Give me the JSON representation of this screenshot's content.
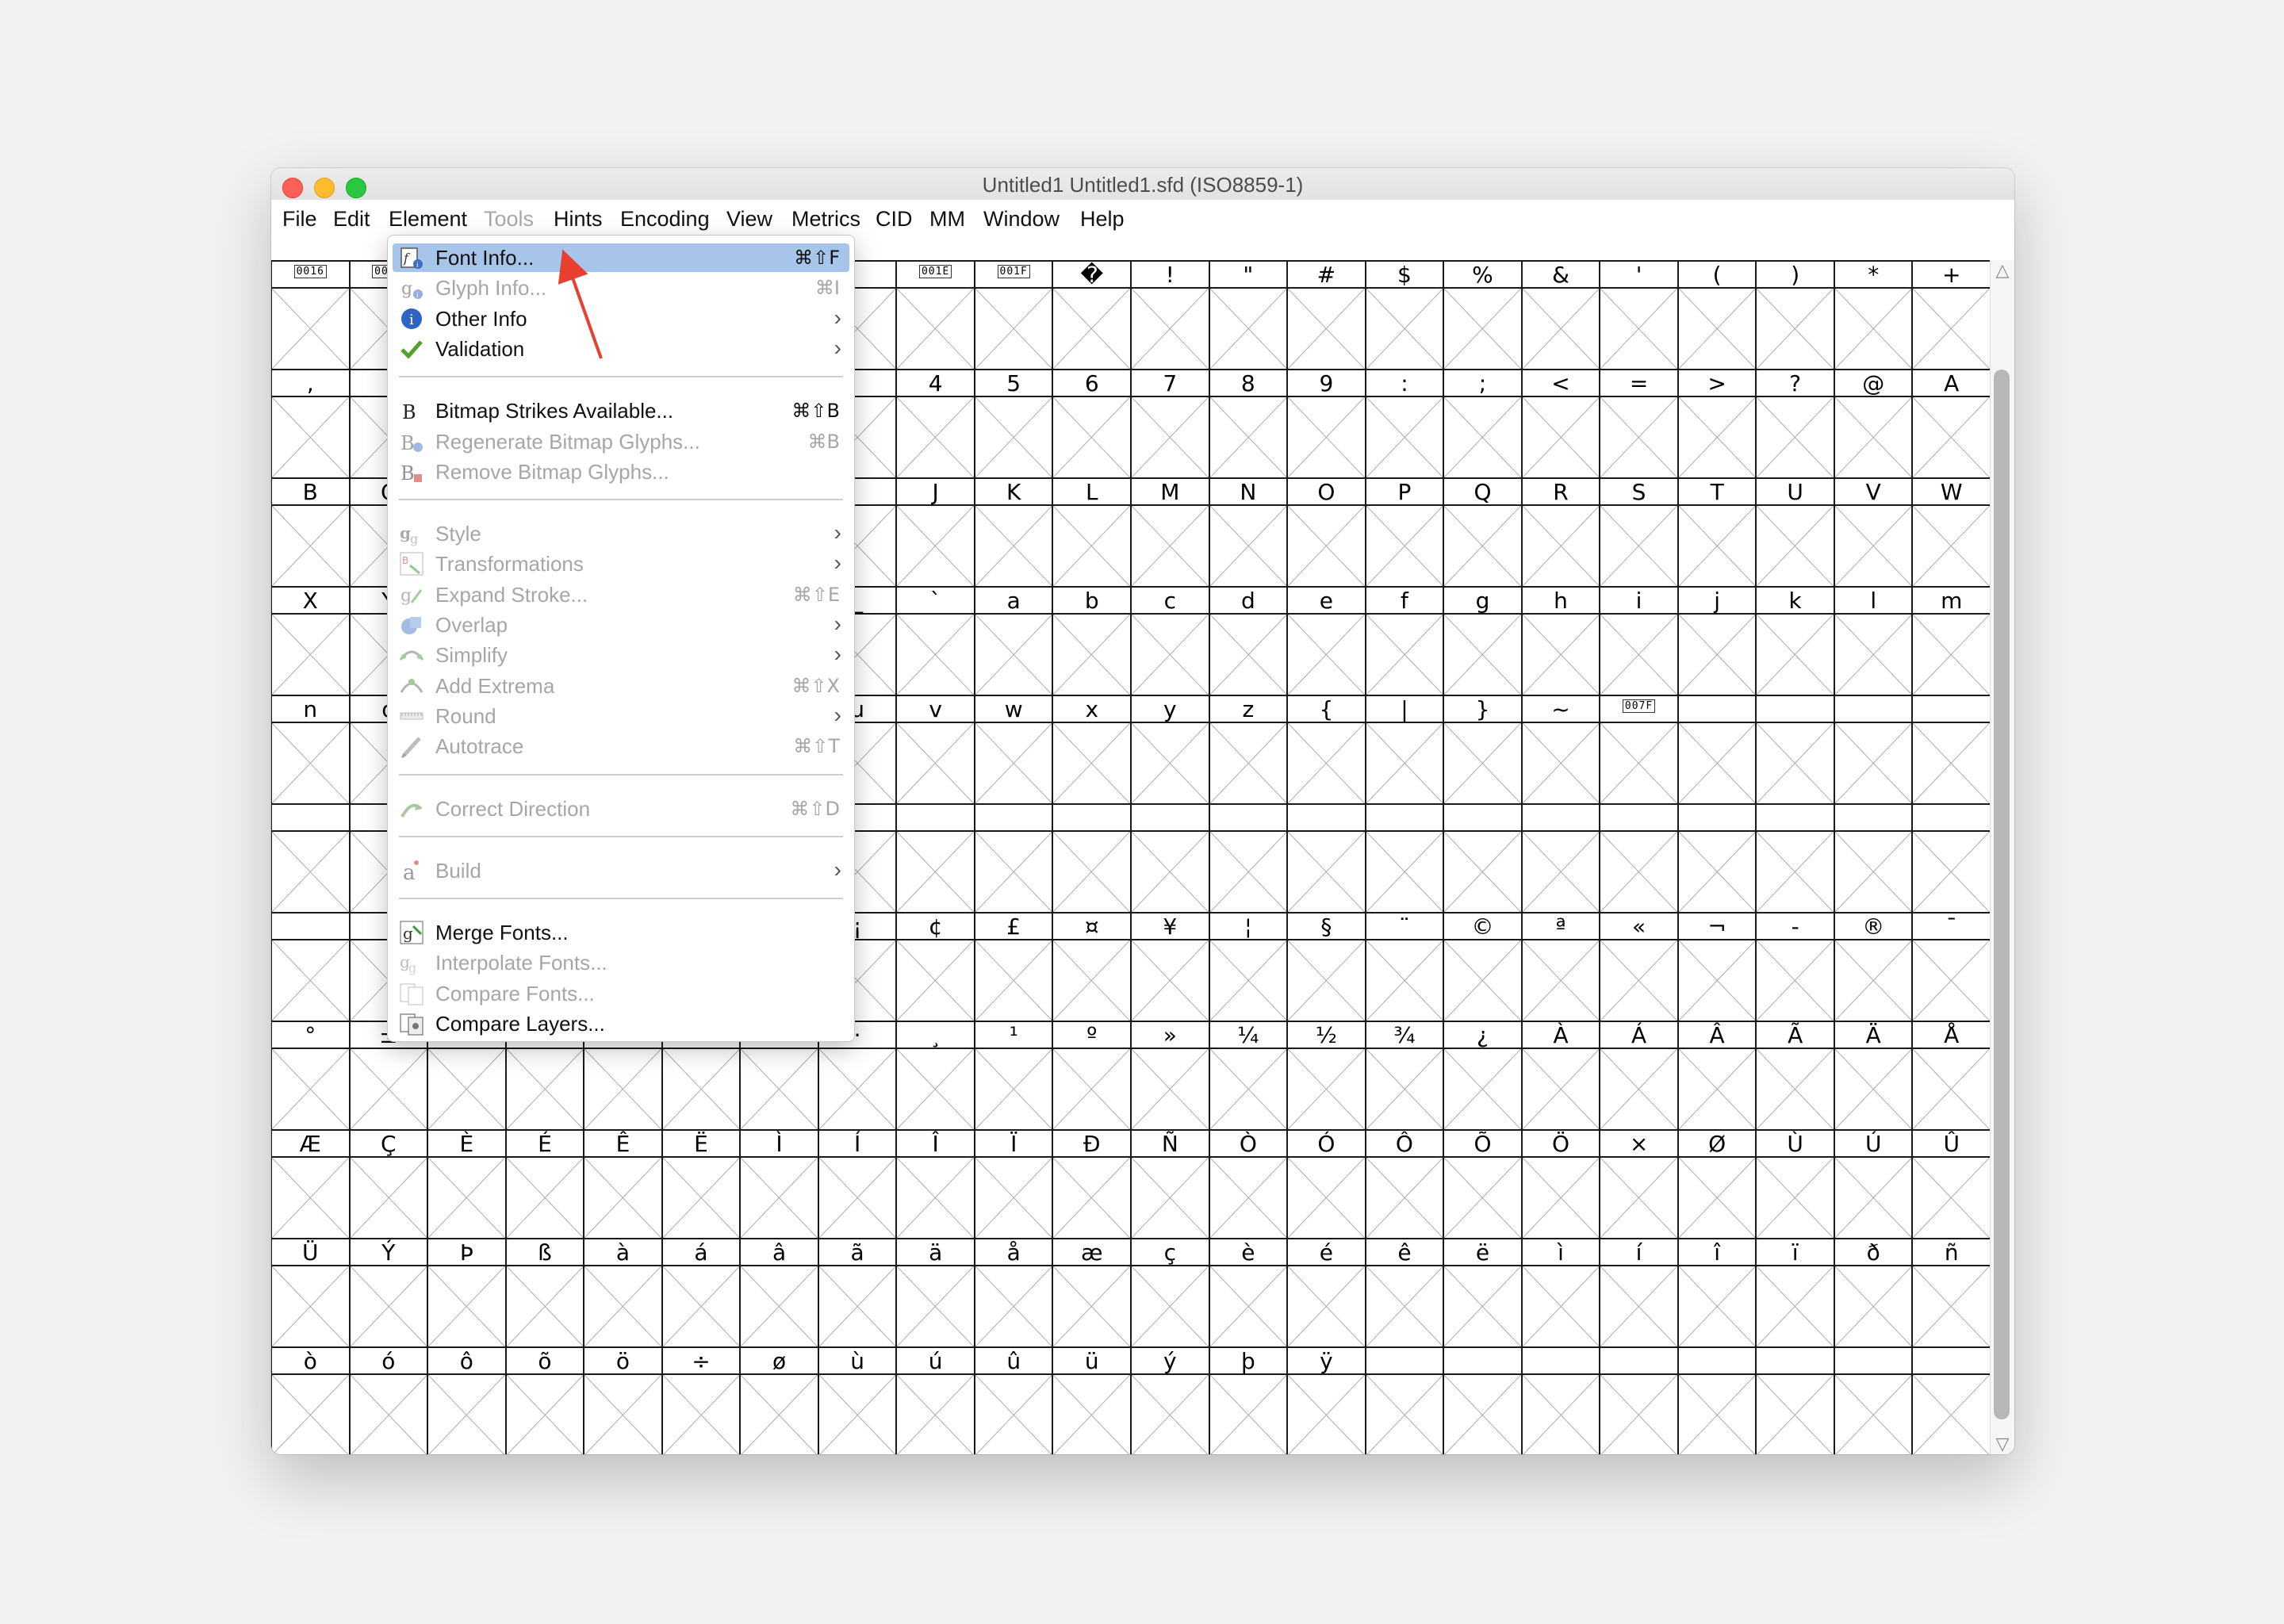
{
  "window": {
    "title": "Untitled1  Untitled1.sfd (ISO8859-1)"
  },
  "menubar": [
    {
      "label": "File",
      "enabled": true
    },
    {
      "label": "Edit",
      "enabled": true
    },
    {
      "label": "Element",
      "enabled": true
    },
    {
      "label": "Tools",
      "enabled": false
    },
    {
      "label": "Hints",
      "enabled": true
    },
    {
      "label": "Encoding",
      "enabled": true
    },
    {
      "label": "View",
      "enabled": true
    },
    {
      "label": "Metrics",
      "enabled": true
    },
    {
      "label": "CID",
      "enabled": true
    },
    {
      "label": "MM",
      "enabled": true
    },
    {
      "label": "Window",
      "enabled": true
    },
    {
      "label": "Help",
      "enabled": true
    }
  ],
  "element_menu": [
    {
      "label": "Font Info...",
      "shortcut": "⌘⇧F",
      "enabled": true,
      "highlighted": true,
      "icon": "font-info-icon"
    },
    {
      "label": "Glyph Info...",
      "shortcut": "⌘I",
      "enabled": false,
      "icon": "glyph-info-icon"
    },
    {
      "label": "Other Info",
      "submenu": true,
      "enabled": true,
      "icon": "info-icon"
    },
    {
      "label": "Validation",
      "submenu": true,
      "enabled": true,
      "icon": "checkmark-icon"
    },
    {
      "separator": true
    },
    {
      "label": "Bitmap Strikes Available...",
      "shortcut": "⌘⇧B",
      "enabled": true,
      "icon": "bitmap-strikes-icon"
    },
    {
      "label": "Regenerate Bitmap Glyphs...",
      "shortcut": "⌘B",
      "enabled": false,
      "icon": "regenerate-bitmap-icon"
    },
    {
      "label": "Remove Bitmap Glyphs...",
      "enabled": false,
      "icon": "remove-bitmap-icon"
    },
    {
      "separator": true
    },
    {
      "label": "Style",
      "submenu": true,
      "enabled": false,
      "icon": "style-icon"
    },
    {
      "label": "Transformations",
      "submenu": true,
      "enabled": false,
      "icon": "transformations-icon"
    },
    {
      "label": "Expand Stroke...",
      "shortcut": "⌘⇧E",
      "enabled": false,
      "icon": "expand-stroke-icon"
    },
    {
      "label": "Overlap",
      "submenu": true,
      "enabled": false,
      "icon": "overlap-icon"
    },
    {
      "label": "Simplify",
      "submenu": true,
      "enabled": false,
      "icon": "simplify-icon"
    },
    {
      "label": "Add Extrema",
      "shortcut": "⌘⇧X",
      "enabled": false,
      "icon": "add-extrema-icon"
    },
    {
      "label": "Round",
      "submenu": true,
      "enabled": false,
      "icon": "round-icon"
    },
    {
      "label": "Autotrace",
      "shortcut": "⌘⇧T",
      "enabled": false,
      "icon": "autotrace-icon"
    },
    {
      "separator": true
    },
    {
      "label": "Correct Direction",
      "shortcut": "⌘⇧D",
      "enabled": false,
      "icon": "correct-direction-icon"
    },
    {
      "separator": true
    },
    {
      "label": "Build",
      "submenu": true,
      "enabled": false,
      "icon": "build-icon"
    },
    {
      "separator": true
    },
    {
      "label": "Merge Fonts...",
      "enabled": true,
      "icon": "merge-fonts-icon"
    },
    {
      "label": "Interpolate Fonts...",
      "enabled": false,
      "icon": "interpolate-fonts-icon"
    },
    {
      "label": "Compare Fonts...",
      "enabled": false,
      "icon": "compare-fonts-icon"
    },
    {
      "label": "Compare Layers...",
      "enabled": true,
      "icon": "compare-layers-icon"
    }
  ],
  "glyph_grid": {
    "columns": 22,
    "rows": [
      [
        "\u001e",
        "\u001e",
        "",
        "",
        "",
        "",
        "",
        "",
        "\u001e",
        "\u001e",
        "�",
        "!",
        "\"",
        "#",
        "$",
        "%",
        "&",
        "'",
        "(",
        ")",
        "*",
        "+"
      ],
      [
        ",",
        "",
        "",
        "",
        "",
        "",
        "",
        "",
        "4",
        "5",
        "6",
        "7",
        "8",
        "9",
        ":",
        ";",
        "<",
        "=",
        ">",
        "?",
        "@",
        "A"
      ],
      [
        "B",
        "C",
        "",
        "",
        "",
        "",
        "",
        "",
        "J",
        "K",
        "L",
        "M",
        "N",
        "O",
        "P",
        "Q",
        "R",
        "S",
        "T",
        "U",
        "V",
        "W"
      ],
      [
        "X",
        "Y",
        "",
        "",
        "",
        "",
        "",
        "_",
        "`",
        "a",
        "b",
        "c",
        "d",
        "e",
        "f",
        "g",
        "h",
        "i",
        "j",
        "k",
        "l",
        "m"
      ],
      [
        "n",
        "o",
        "",
        "",
        "",
        "",
        "",
        "u",
        "v",
        "w",
        "x",
        "y",
        "z",
        "{",
        "|",
        "}",
        "~",
        "\u001e",
        "",
        "",
        "",
        ""
      ],
      [
        "",
        "",
        "",
        "",
        "",
        "",
        "",
        "",
        "",
        "",
        "",
        "",
        "",
        "",
        "",
        "",
        "",
        "",
        "",
        "",
        "",
        ""
      ],
      [
        "",
        "",
        "",
        "",
        "",
        "",
        "",
        "¡",
        "¢",
        "£",
        "¤",
        "¥",
        "¦",
        "§",
        "¨",
        "©",
        "ª",
        "«",
        "¬",
        "-",
        "®",
        "¯"
      ],
      [
        "°",
        "±",
        "",
        "",
        "",
        "",
        "",
        "·",
        "¸",
        "¹",
        "º",
        "»",
        "¼",
        "½",
        "¾",
        "¿",
        "À",
        "Á",
        "Â",
        "Ã",
        "Ä",
        "Å"
      ],
      [
        "Æ",
        "Ç",
        "È",
        "É",
        "Ê",
        "Ë",
        "Ì",
        "Í",
        "Î",
        "Ï",
        "Ð",
        "Ñ",
        "Ò",
        "Ó",
        "Ô",
        "Õ",
        "Ö",
        "×",
        "Ø",
        "Ù",
        "Ú",
        "Û"
      ],
      [
        "Ü",
        "Ý",
        "Þ",
        "ß",
        "à",
        "á",
        "â",
        "ã",
        "ä",
        "å",
        "æ",
        "ç",
        "è",
        "é",
        "ê",
        "ë",
        "ì",
        "í",
        "î",
        "ï",
        "ð",
        "ñ"
      ],
      [
        "ò",
        "ó",
        "ô",
        "õ",
        "ö",
        "÷",
        "ø",
        "ù",
        "ú",
        "û",
        "ü",
        "ý",
        "þ",
        "ÿ",
        "",
        "",
        "",
        "",
        "",
        "",
        "",
        ""
      ]
    ],
    "hex_box_labels": {
      "0,0": "0016",
      "0,1": "0017",
      "0,8": "001E",
      "0,9": "001F",
      "4,17": "007F"
    }
  },
  "colors": {
    "highlight": "#a7c4ea",
    "annotation_arrow": "#e8402f",
    "close": "#fe5f57",
    "minimize": "#febc2e",
    "zoom": "#28c840"
  }
}
